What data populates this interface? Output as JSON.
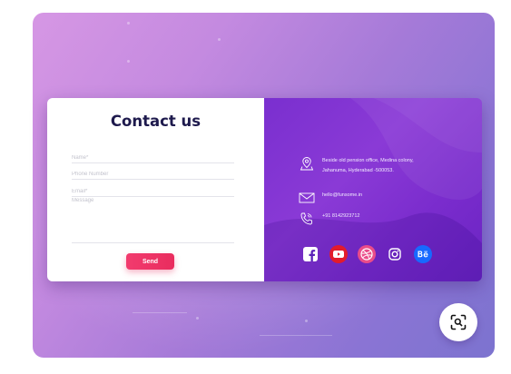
{
  "form": {
    "title": "Contact us",
    "name_placeholder": "Name*",
    "phone_placeholder": "Phone Number",
    "email_placeholder": "Email*",
    "message_placeholder": "Message",
    "send_label": "Send"
  },
  "info": {
    "address_line1": "Beside old pension office, Medina colony,",
    "address_line2": "Jahanuma, Hyderabad -500053.",
    "email": "hello@funsome.in",
    "phone": "+91 8142923712"
  },
  "socials": [
    "facebook-icon",
    "youtube-icon",
    "dribbble-icon",
    "instagram-icon",
    "behance-icon"
  ],
  "colors": {
    "title": "#1e1a4d",
    "send_button": "#ec2f62",
    "info_panel": "#7a2fcf",
    "background_start": "#d697e4",
    "background_end": "#7c73cf"
  },
  "fab_icon": "zoom-scan-icon"
}
